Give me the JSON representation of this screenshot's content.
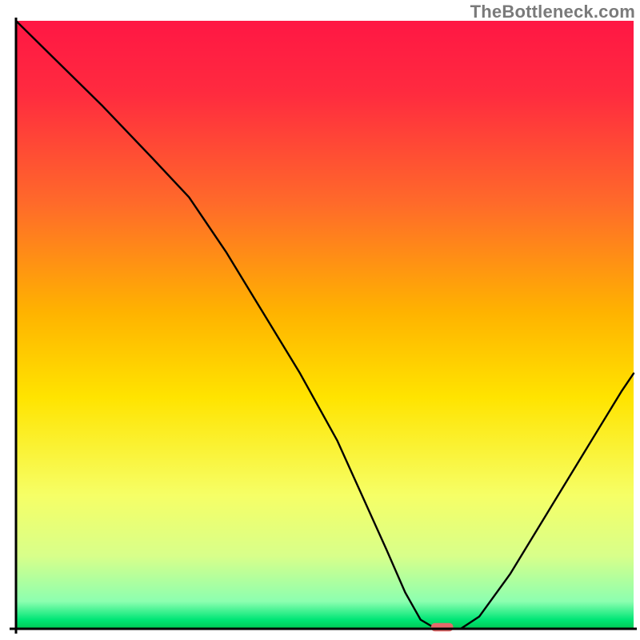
{
  "watermark": "TheBottleneck.com",
  "chart_data": {
    "type": "line",
    "title": "",
    "xlabel": "",
    "ylabel": "",
    "xlim": [
      0,
      100
    ],
    "ylim": [
      0,
      100
    ],
    "grid": false,
    "legend": false,
    "notes": "Single black curve over a vertical rainbow gradient background. Y ≈ bottleneck percentage; X ≈ component performance scale. Values estimated from pixel positions (no axis ticks rendered). Red rounded marker near the curve minimum.",
    "gradient_stops": [
      {
        "offset": 0.0,
        "color": "#ff1744"
      },
      {
        "offset": 0.12,
        "color": "#ff2b3f"
      },
      {
        "offset": 0.3,
        "color": "#ff6a2a"
      },
      {
        "offset": 0.48,
        "color": "#ffb300"
      },
      {
        "offset": 0.62,
        "color": "#ffe400"
      },
      {
        "offset": 0.78,
        "color": "#f6ff66"
      },
      {
        "offset": 0.88,
        "color": "#d8ff8a"
      },
      {
        "offset": 0.955,
        "color": "#8cffb0"
      },
      {
        "offset": 0.985,
        "color": "#00e676"
      },
      {
        "offset": 1.0,
        "color": "#00c853"
      }
    ],
    "series": [
      {
        "name": "bottleneck-curve",
        "x": [
          0.0,
          6.0,
          14.0,
          22.0,
          28.0,
          34.0,
          40.0,
          46.0,
          52.0,
          56.0,
          60.0,
          63.0,
          65.5,
          68.0,
          72.0,
          75.0,
          80.0,
          86.0,
          92.0,
          98.0,
          100.0
        ],
        "y": [
          100.0,
          94.0,
          86.0,
          77.5,
          71.0,
          62.0,
          52.0,
          42.0,
          31.0,
          22.0,
          13.0,
          6.0,
          1.5,
          0.0,
          0.0,
          2.0,
          9.0,
          19.0,
          29.0,
          39.0,
          42.0
        ]
      }
    ],
    "marker": {
      "name": "optimal-marker",
      "x": 69.0,
      "y": 0.0,
      "width_pct": 3.6,
      "height_pct": 1.4,
      "color": "#e26a6a"
    },
    "axis_color": "#000000",
    "background": "#ffffff"
  }
}
